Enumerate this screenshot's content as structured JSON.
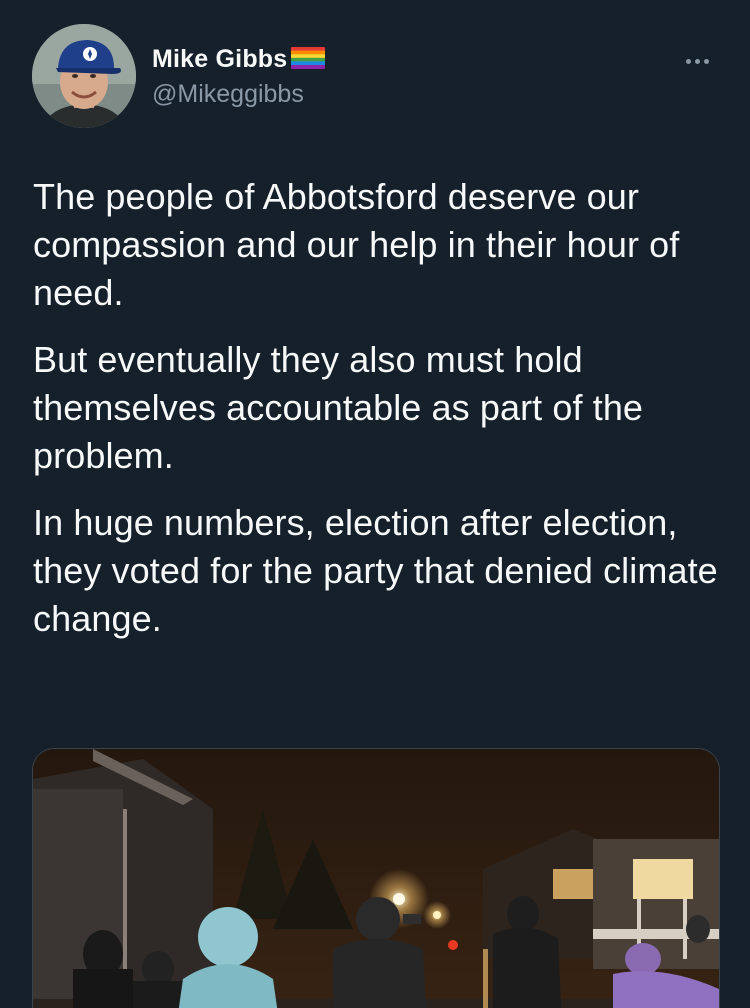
{
  "author": {
    "display_name": "Mike Gibbs",
    "handle": "@Mikeggibbs",
    "name_emoji": "rainbow-flag-icon"
  },
  "tweet": {
    "paragraphs": [
      "The people of Abbotsford deserve our compassion and our help in their hour of need.",
      "But eventually they also must hold themselves accountable as part of the problem.",
      "In huge numbers, election after election, they voted for the party that denied climate change."
    ]
  },
  "media": {
    "icon": "night-street-photo"
  },
  "colors": {
    "background": "#15202b",
    "text_primary": "#f7f9f9",
    "text_secondary": "#8b98a5",
    "border": "#38444d"
  }
}
